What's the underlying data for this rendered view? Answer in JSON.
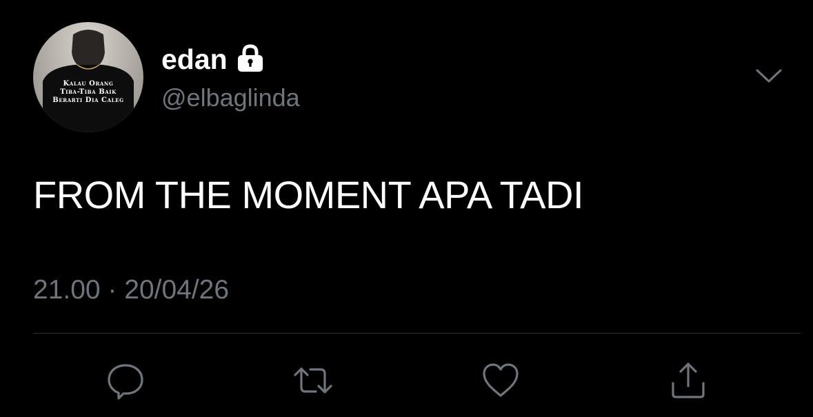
{
  "tweet": {
    "author": {
      "display_name": "edan",
      "handle": "@elbaglinda",
      "protected_icon": "lock-icon",
      "avatar_caption": [
        "Kalau Orang",
        "Tiba-Tiba Baik",
        "Berarti Dia Caleg"
      ]
    },
    "text": "FROM THE MOMENT APA TADI",
    "timestamp": "21.00 · 20/04/26",
    "menu_icon": "chevron-down-icon"
  },
  "actions": [
    {
      "name": "reply",
      "icon": "reply-icon"
    },
    {
      "name": "retweet",
      "icon": "retweet-icon"
    },
    {
      "name": "like",
      "icon": "heart-icon"
    },
    {
      "name": "share",
      "icon": "share-icon"
    }
  ],
  "colors": {
    "background": "#000000",
    "primary_text": "#ffffff",
    "secondary_text": "#6e767d",
    "divider": "#2f3336",
    "icon": "#6e767d"
  }
}
